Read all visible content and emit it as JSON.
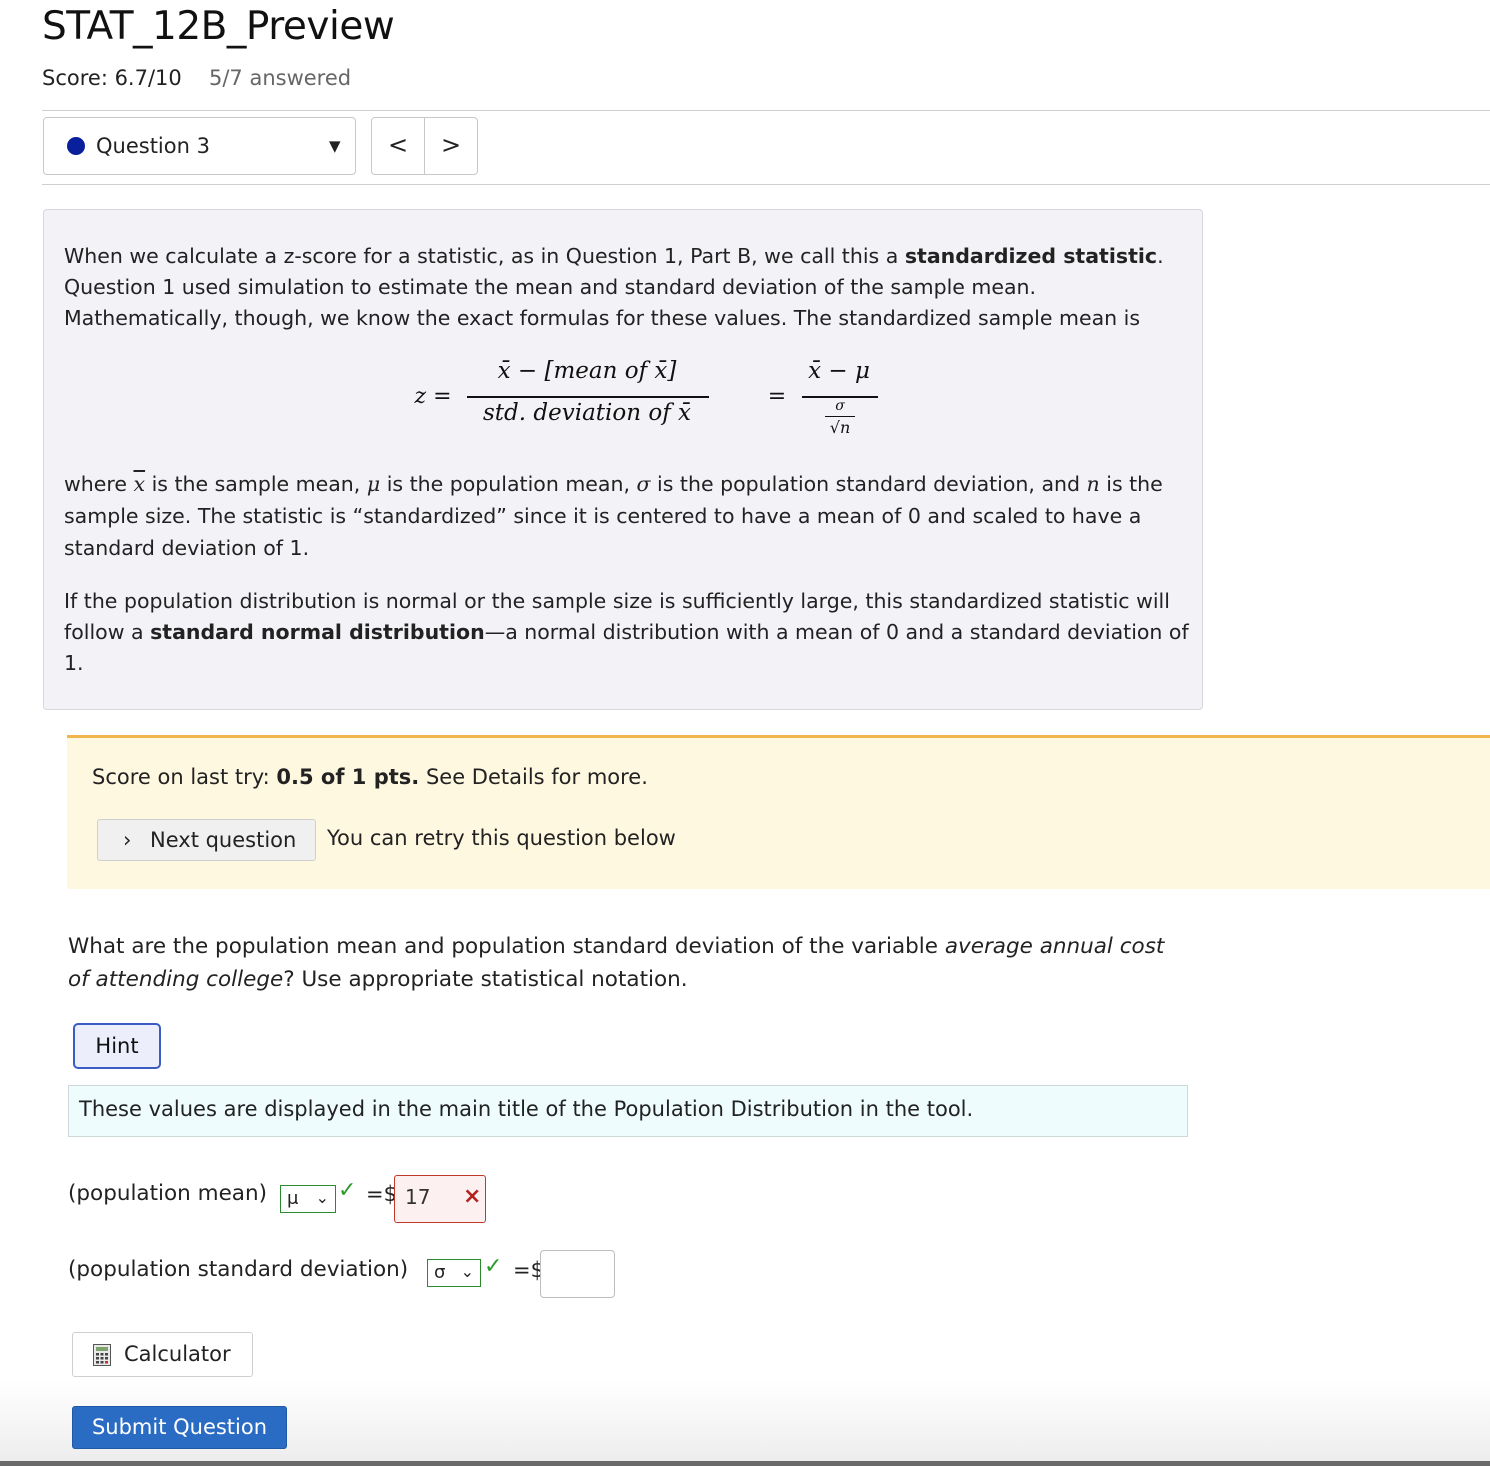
{
  "header": {
    "title": "STAT_12B_Preview",
    "score": "Score: 6.7/10",
    "answered": "5/7 answered"
  },
  "nav": {
    "question_label": "Question 3",
    "prev_label": "<",
    "next_label": ">",
    "dot_color": "#0a1f9c"
  },
  "intro": {
    "p1_a": "When we calculate a z-score for a statistic, as in Question 1, Part B, we call this a ",
    "p1_bold": "standardized statistic",
    "p1_b": ". Question 1 used simulation to estimate the mean and standard deviation of the sample mean. Mathematically, though, we know the exact formulas for these values. The standardized sample mean is",
    "formula": {
      "lhs": "z =",
      "num1": "x̄ − [mean of x̄]",
      "den1": "std. deviation of x̄",
      "eq": "=",
      "num2": "x̄ − μ",
      "den2_top": "σ",
      "den2_bottom": "√n"
    },
    "p2_where": "where ",
    "p2_xbar": "x",
    "p2_a": " is the sample mean, ",
    "p2_mu": "μ",
    "p2_b": " is the population mean, ",
    "p2_sigma": "σ",
    "p2_c": " is the population standard deviation, and ",
    "p2_n": "n",
    "p2_d": " is the sample size. The statistic is “standardized” since it is centered to have a mean of 0 and scaled to have a standard deviation of 1.",
    "p3_a": "If the population distribution is normal or the sample size is sufficiently large, this standardized statistic will follow a ",
    "p3_bold": "standard normal distribution",
    "p3_b": "—a normal distribution with a mean of 0 and a standard deviation of 1."
  },
  "feedback": {
    "last_try_prefix": "Score on last try: ",
    "last_try_bold": "0.5 of 1 pts.",
    "last_try_suffix": " See Details for more.",
    "next_question_chevron": "›",
    "next_question_label": "Next question",
    "retry_text": "You can retry this question below"
  },
  "question": {
    "text_a": "What are the population mean and population standard deviation of the variable ",
    "text_italic": "average annual cost of attending college",
    "text_b": "? Use appropriate statistical notation.",
    "hint_label": "Hint",
    "hint_text": "These values are displayed in the main title of the Population Distribution in the tool."
  },
  "answers": {
    "mean_label": "(population mean)",
    "mean_symbol": "μ",
    "mean_eq": "=$",
    "mean_value": "17",
    "mean_status_icon": "×",
    "sd_label": "(population standard deviation)",
    "sd_symbol": "σ",
    "sd_eq": "=$",
    "sd_value": "",
    "check_icon": "✓",
    "select_chevron": "⌄"
  },
  "actions": {
    "calculator_label": "Calculator",
    "submit_label": "Submit Question"
  },
  "colors": {
    "accent": "#2a6cc4",
    "correct": "#2c9b2c",
    "incorrect": "#b2231e",
    "feedback_bg": "#fff8e1"
  }
}
